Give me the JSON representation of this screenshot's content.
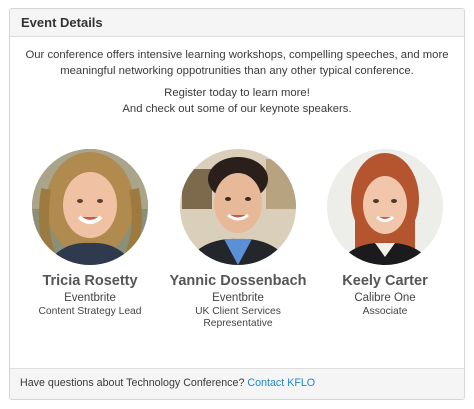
{
  "panel": {
    "title": "Event Details"
  },
  "intro": {
    "paragraph1": "Our conference offers intensive learning workshops, compelling speeches, and more meaningful networking oppotrunities than any other typical conference.",
    "paragraph2_line1": "Register today to learn more!",
    "paragraph2_line2": "And check out some of our keynote speakers."
  },
  "speakers": [
    {
      "name": "Tricia Rosetty",
      "company": "Eventbrite",
      "role": "Content Strategy Lead"
    },
    {
      "name": "Yannic Dossenbach",
      "company": "Eventbrite",
      "role_line1": "UK Client Services",
      "role_line2": "Representative"
    },
    {
      "name": "Keely Carter",
      "company": "Calibre One",
      "role": "Associate"
    }
  ],
  "footer": {
    "question": "Have questions about Technology Conference?",
    "link_label": "Contact KFLO"
  },
  "colors": {
    "link": "#1e86c6",
    "header_bg": "#f5f5f5",
    "border": "#d6d6d6"
  }
}
